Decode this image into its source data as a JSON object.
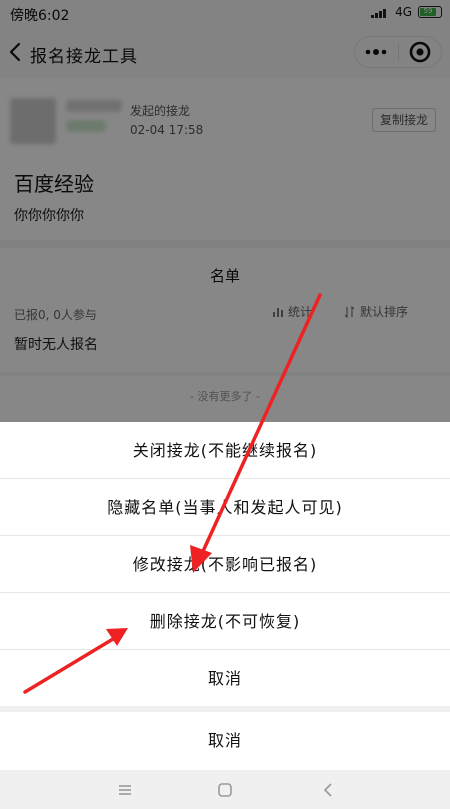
{
  "status_bar": {
    "time": "傍晚6:02",
    "network": "4G",
    "battery": "59"
  },
  "nav": {
    "title": "报名接龙工具",
    "more_icon": "more-dots-icon",
    "target_icon": "target-icon",
    "back_icon": "chevron-left-icon"
  },
  "creator": {
    "label": "发起的接龙",
    "time": "02-04 17:58",
    "copy_button": "复制接龙"
  },
  "event": {
    "title": "百度经验",
    "description": "你你你你你"
  },
  "list": {
    "header": "名单",
    "count": "已报0, 0人参与",
    "stats": "统计",
    "sort": "默认排序",
    "empty": "暂时无人报名",
    "no_more": "- 没有更多了 -"
  },
  "action_sheet": {
    "items": [
      "关闭接龙(不能继续报名)",
      "隐藏名单(当事人和发起人可见)",
      "修改接龙(不影响已报名)",
      "删除接龙(不可恢复)",
      "取消"
    ],
    "cancel": "取消"
  },
  "colors": {
    "overlay": "#000000",
    "annotation_arrow": "#ee2222",
    "battery": "#3cb64a"
  }
}
